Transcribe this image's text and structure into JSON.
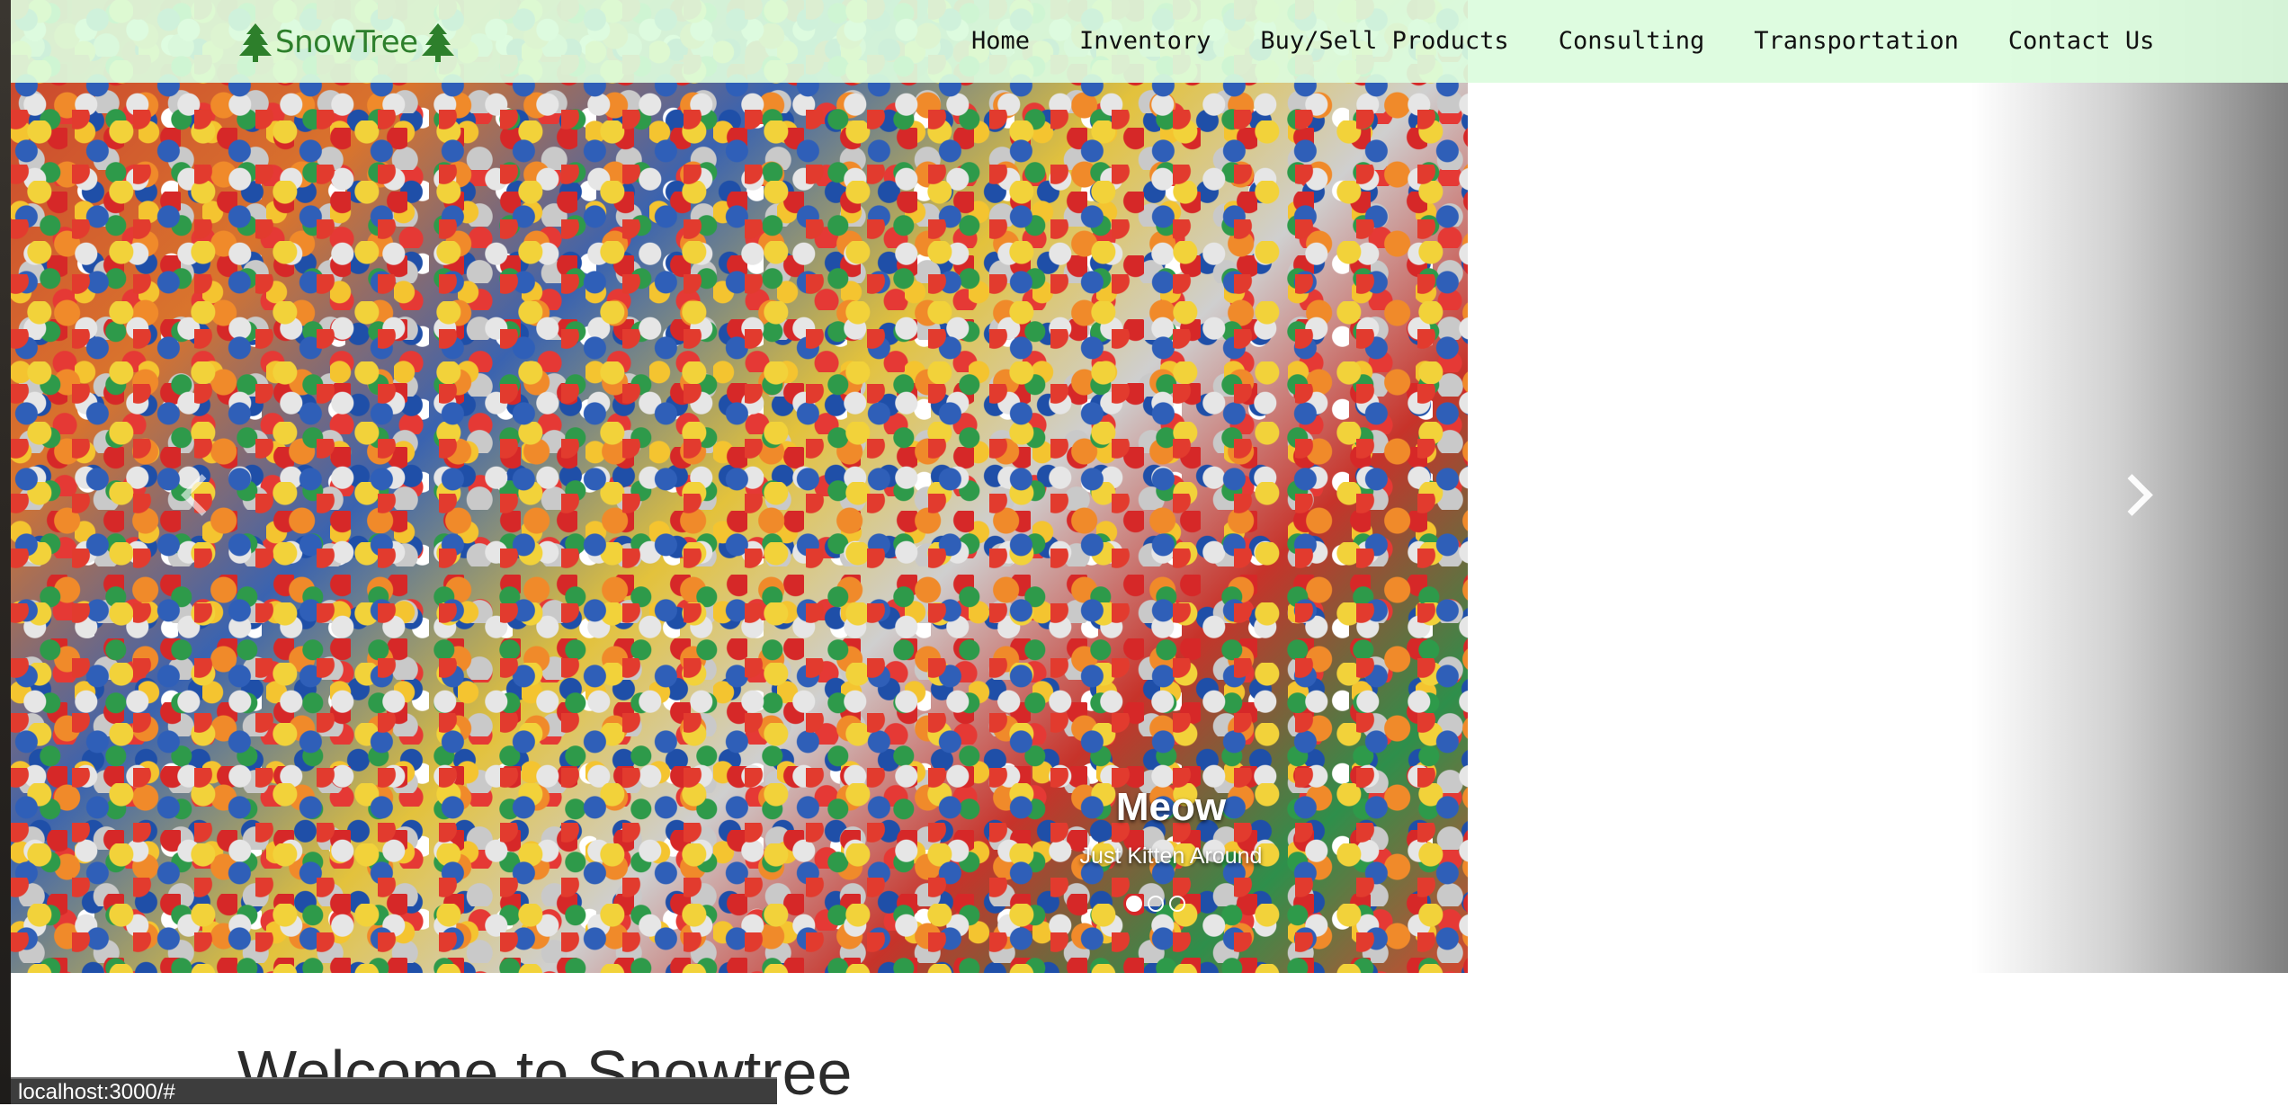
{
  "brand": {
    "name": "SnowTree",
    "icon": "tree-icon",
    "color": "#2d7f2b"
  },
  "nav": {
    "items": [
      {
        "label": "Home"
      },
      {
        "label": "Inventory"
      },
      {
        "label": "Buy/Sell Products"
      },
      {
        "label": "Consulting"
      },
      {
        "label": "Transportation"
      },
      {
        "label": "Contact Us"
      }
    ],
    "background": "#dcfcde"
  },
  "carousel": {
    "caption_title": "Meow",
    "caption_text": "Just Kitten Around",
    "slide_count": 3,
    "active_index": 0,
    "prev_icon": "chevron-left-icon",
    "next_icon": "chevron-right-icon"
  },
  "main": {
    "heading": "Welcome to Snowtree"
  },
  "status_bar": {
    "url": "localhost:3000/#"
  }
}
